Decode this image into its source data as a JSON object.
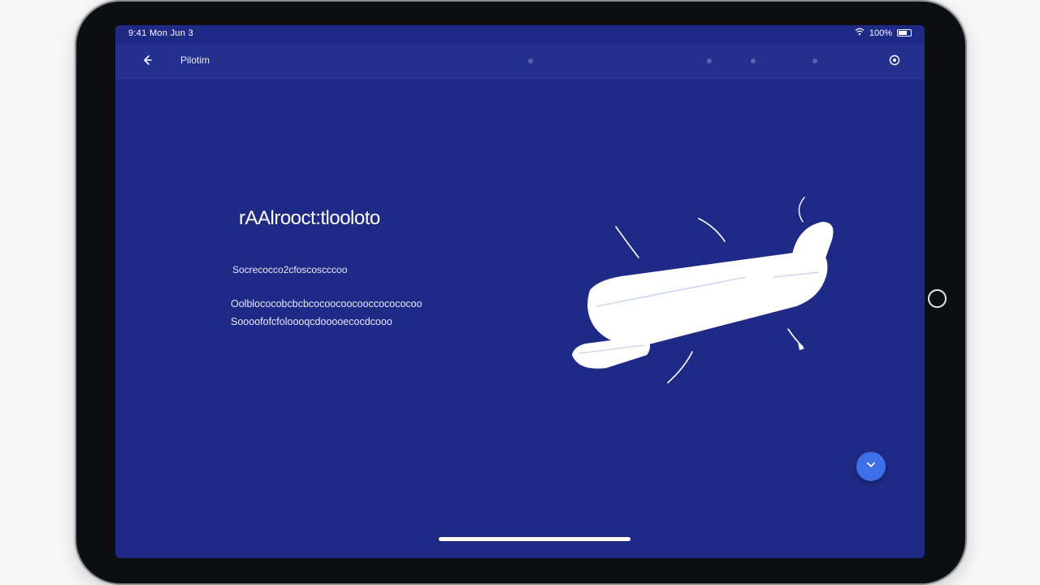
{
  "status_bar": {
    "time": "9:41 Mon Jun 3",
    "battery": "100%"
  },
  "app_bar": {
    "title": "Pilotim"
  },
  "hero": {
    "headline": "rAAlrooct:tlooloto",
    "subtitle": "Socrecocco2cfoscoscccoo",
    "body_lines": [
      "Oolblococobcbcbcocoocoocooccocococoo",
      "Soooofofcfoloooqcdooooecocdcooo"
    ]
  },
  "icons": {
    "back": "back-arrow-icon",
    "settings": "settings-icon",
    "fab": "chevron-down-icon",
    "illustration": "airplane-illustration"
  },
  "colors": {
    "screen_background": "#1f2a86",
    "app_bar": "#24308e",
    "fab": "#3c6fe8",
    "text": "#ffffff"
  }
}
